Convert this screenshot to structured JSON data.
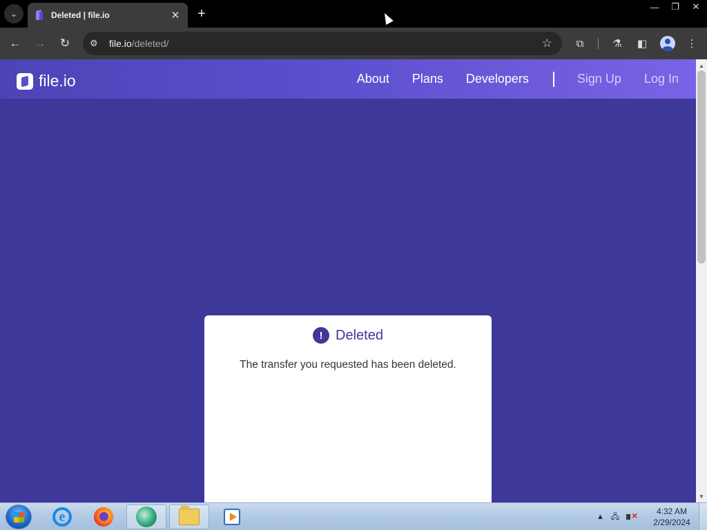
{
  "browser": {
    "tab": {
      "title": "Deleted | file.io",
      "close_glyph": "✕"
    },
    "tab_search_glyph": "⌄",
    "new_tab_glyph": "+",
    "window_controls": {
      "minimize": "—",
      "restore": "❐",
      "close": "✕"
    },
    "nav": {
      "back": "←",
      "forward": "→",
      "reload": "↻"
    },
    "address": {
      "host": "file.io",
      "path": "/deleted/",
      "site_info_glyph": "⚙"
    },
    "bookmark_glyph": "☆",
    "tools": {
      "extensions": "⧉",
      "labs": "⚗",
      "side_panel": "◧",
      "menu": "⋮"
    }
  },
  "site": {
    "logo_text": "file.io",
    "nav": {
      "about": "About",
      "plans": "Plans",
      "developers": "Developers",
      "sign_up": "Sign Up",
      "log_in": "Log In"
    },
    "colors": {
      "background": "#3e389a",
      "nav_start": "#4c44b6",
      "nav_end": "#7a63e6"
    }
  },
  "card": {
    "alert_glyph": "!",
    "title": "Deleted",
    "message": "The transfer you requested has been deleted."
  },
  "scrollbar": {
    "up_glyph": "▲",
    "down_glyph": "▼"
  },
  "taskbar": {
    "items": [
      "start-orb",
      "internet-explorer",
      "firefox",
      "app",
      "file-explorer",
      "media-player"
    ],
    "tray_arrow": "▲",
    "tray_network": "🖧",
    "clock": {
      "time": "4:32 AM",
      "date": "2/29/2024"
    }
  }
}
